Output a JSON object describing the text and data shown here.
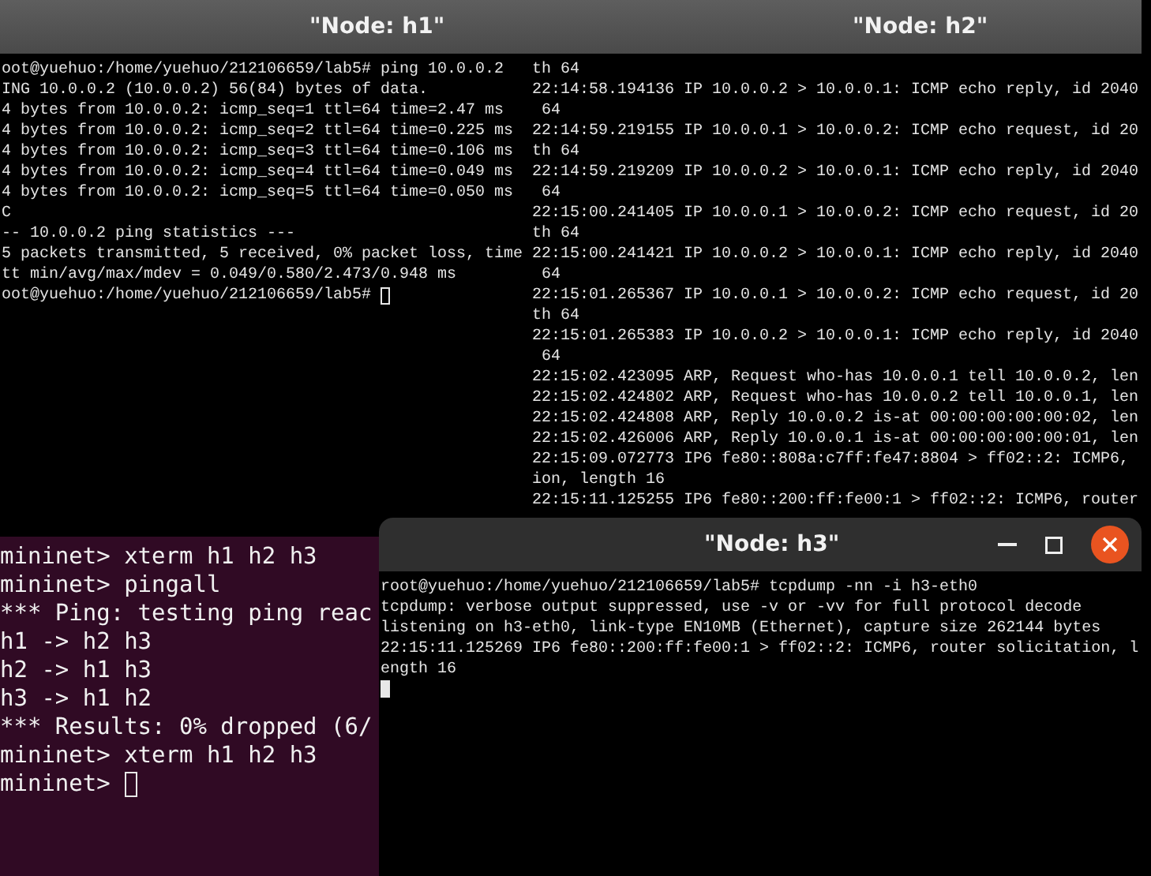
{
  "windows": [
    {
      "kind": "xterm",
      "title": "\"Node: h1\"",
      "active": false,
      "lines": [
        "oot@yuehuo:/home/yuehuo/212106659/lab5# ping 10.0.0.2",
        "ING 10.0.0.2 (10.0.0.2) 56(84) bytes of data.",
        "4 bytes from 10.0.0.2: icmp_seq=1 ttl=64 time=2.47 ms",
        "4 bytes from 10.0.0.2: icmp_seq=2 ttl=64 time=0.225 ms",
        "4 bytes from 10.0.0.2: icmp_seq=3 ttl=64 time=0.106 ms",
        "4 bytes from 10.0.0.2: icmp_seq=4 ttl=64 time=0.049 ms",
        "4 bytes from 10.0.0.2: icmp_seq=5 ttl=64 time=0.050 ms",
        "C",
        "-- 10.0.0.2 ping statistics ---",
        "5 packets transmitted, 5 received, 0% packet loss, time",
        "tt min/avg/max/mdev = 0.049/0.580/2.473/0.948 ms"
      ],
      "prompt": {
        "text": "oot@yuehuo:/home/yuehuo/212106659/lab5#",
        "cursor_filled": false
      }
    },
    {
      "kind": "xterm",
      "title": "\"Node: h2\"",
      "active": false,
      "lines": [
        "th 64",
        "22:14:58.194136 IP 10.0.0.2 > 10.0.0.1: ICMP echo reply, id 2040",
        " 64",
        "22:14:59.219155 IP 10.0.0.1 > 10.0.0.2: ICMP echo request, id 20",
        "th 64",
        "22:14:59.219209 IP 10.0.0.2 > 10.0.0.1: ICMP echo reply, id 2040",
        " 64",
        "22:15:00.241405 IP 10.0.0.1 > 10.0.0.2: ICMP echo request, id 20",
        "th 64",
        "22:15:00.241421 IP 10.0.0.2 > 10.0.0.1: ICMP echo reply, id 2040",
        " 64",
        "22:15:01.265367 IP 10.0.0.1 > 10.0.0.2: ICMP echo request, id 20",
        "th 64",
        "22:15:01.265383 IP 10.0.0.2 > 10.0.0.1: ICMP echo reply, id 2040",
        " 64",
        "22:15:02.423095 ARP, Request who-has 10.0.0.1 tell 10.0.0.2, len",
        "22:15:02.424802 ARP, Request who-has 10.0.0.2 tell 10.0.0.1, len",
        "22:15:02.424808 ARP, Reply 10.0.0.2 is-at 00:00:00:00:00:02, len",
        "22:15:02.426006 ARP, Reply 10.0.0.1 is-at 00:00:00:00:00:01, len",
        "22:15:09.072773 IP6 fe80::808a:c7ff:fe47:8804 > ff02::2: ICMP6,",
        "ion, length 16",
        "22:15:11.125255 IP6 fe80::200:ff:fe00:1 > ff02::2: ICMP6, router"
      ]
    },
    {
      "kind": "mininet",
      "lines": [
        "mininet> xterm h1 h2 h3",
        "mininet> pingall",
        "*** Ping: testing ping reac",
        "h1 -> h2 h3",
        "h2 -> h1 h3",
        "h3 -> h1 h2",
        "*** Results: 0% dropped (6/",
        "mininet> xterm h1 h2 h3"
      ],
      "prompt": {
        "text": "mininet>",
        "cursor_filled": false
      }
    },
    {
      "kind": "xterm",
      "title": "\"Node: h3\"",
      "active": true,
      "lines": [
        "root@yuehuo:/home/yuehuo/212106659/lab5# tcpdump -nn -i h3-eth0",
        "tcpdump: verbose output suppressed, use -v or -vv for full protocol decode",
        "listening on h3-eth0, link-type EN10MB (Ethernet), capture size 262144 bytes",
        "22:15:11.125269 IP6 fe80::200:ff:fe00:1 > ff02::2: ICMP6, router solicitation, l",
        "ength 16"
      ],
      "prompt": {
        "cursor_filled": true
      }
    }
  ]
}
